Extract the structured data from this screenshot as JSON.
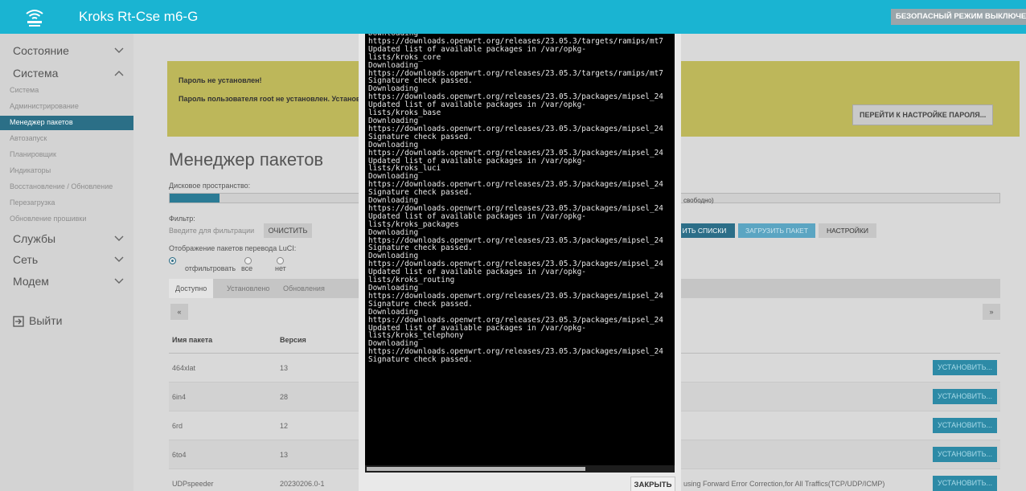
{
  "header": {
    "title": "Kroks Rt-Cse m6-G",
    "safe_mode_badge": "БЕЗОПАСНЫЙ РЕЖИМ ВЫКЛЮЧЕН",
    "accent_color": "#1ab4d2"
  },
  "sidebar": {
    "groups": {
      "status": "Состояние",
      "system": "Система",
      "services": "Службы",
      "network": "Сеть",
      "modem": "Модем"
    },
    "system_items": [
      "Система",
      "Администрирование",
      "Менеджер пакетов",
      "Автозапуск",
      "Планировщик",
      "Индикаторы",
      "Восстановление / Обновление",
      "Перезагрузка",
      "Обновление прошивки"
    ],
    "active_item": "Менеджер пакетов",
    "logout": "Выйти"
  },
  "warning": {
    "title": "Пароль не установлен!",
    "text": "Пароль пользователя root не установлен. Установ",
    "button": "ПЕРЕЙТИ К НАСТРОЙКЕ ПАРОЛЯ..."
  },
  "page": {
    "title": "Менеджер пакетов",
    "disk_label": "Дисковое пространство:",
    "disk_free_text": "свободно)",
    "disk_used_fraction": 0.06,
    "filter_label": "Фильтр:",
    "filter_placeholder": "Введите для фильтрации",
    "clear_button": "ОЧИСТИТЬ",
    "actions_label": ":",
    "update_button": "ИТЬ СПИСКИ",
    "upload_button": "ЗАГРУЗИТЬ ПАКЕТ",
    "config_button": "НАСТРОЙКИ",
    "translation_label": "Отображение пакетов перевода LuCI:",
    "radio_options": [
      "отфильтровать",
      "все",
      "нет"
    ],
    "radio_selected": "отфильтровать",
    "tabs": [
      "Доступно",
      "Установлено",
      "Обновления"
    ],
    "active_tab": "Доступно",
    "prev": "«",
    "next": "»"
  },
  "table": {
    "col_name": "Имя пакета",
    "col_version": "Версия",
    "install_label": "УСТАНОВИТЬ...",
    "rows": [
      {
        "name": "464xlat",
        "version": "13",
        "desc": ""
      },
      {
        "name": "6in4",
        "version": "28",
        "desc": ""
      },
      {
        "name": "6rd",
        "version": "12",
        "desc": ""
      },
      {
        "name": "6to4",
        "version": "13",
        "desc": ""
      },
      {
        "name": "UDPspeeder",
        "version": "20230206.0-1",
        "desc": "using Forward Error Correction,for All Traffics(TCP/UDP/ICMP)"
      }
    ]
  },
  "modal": {
    "console_lines": [
      "Downloading",
      "https://downloads.openwrt.org/releases/23.05.3/targets/ramips/mt7",
      "Updated list of available packages in /var/opkg-",
      "lists/kroks_core",
      "Downloading",
      "https://downloads.openwrt.org/releases/23.05.3/targets/ramips/mt7",
      "Signature check passed.",
      "Downloading",
      "https://downloads.openwrt.org/releases/23.05.3/packages/mipsel_24",
      "Updated list of available packages in /var/opkg-",
      "lists/kroks_base",
      "Downloading",
      "https://downloads.openwrt.org/releases/23.05.3/packages/mipsel_24",
      "Signature check passed.",
      "Downloading",
      "https://downloads.openwrt.org/releases/23.05.3/packages/mipsel_24",
      "Updated list of available packages in /var/opkg-",
      "lists/kroks_luci",
      "Downloading",
      "https://downloads.openwrt.org/releases/23.05.3/packages/mipsel_24",
      "Signature check passed.",
      "Downloading",
      "https://downloads.openwrt.org/releases/23.05.3/packages/mipsel_24",
      "Updated list of available packages in /var/opkg-",
      "lists/kroks_packages",
      "Downloading",
      "https://downloads.openwrt.org/releases/23.05.3/packages/mipsel_24",
      "Signature check passed.",
      "Downloading",
      "https://downloads.openwrt.org/releases/23.05.3/packages/mipsel_24",
      "Updated list of available packages in /var/opkg-",
      "lists/kroks_routing",
      "Downloading",
      "https://downloads.openwrt.org/releases/23.05.3/packages/mipsel_24",
      "Signature check passed.",
      "Downloading",
      "https://downloads.openwrt.org/releases/23.05.3/packages/mipsel_24",
      "Updated list of available packages in /var/opkg-",
      "lists/kroks_telephony",
      "Downloading",
      "https://downloads.openwrt.org/releases/23.05.3/packages/mipsel_24",
      "Signature check passed."
    ],
    "close_button": "ЗАКРЫТЬ"
  }
}
